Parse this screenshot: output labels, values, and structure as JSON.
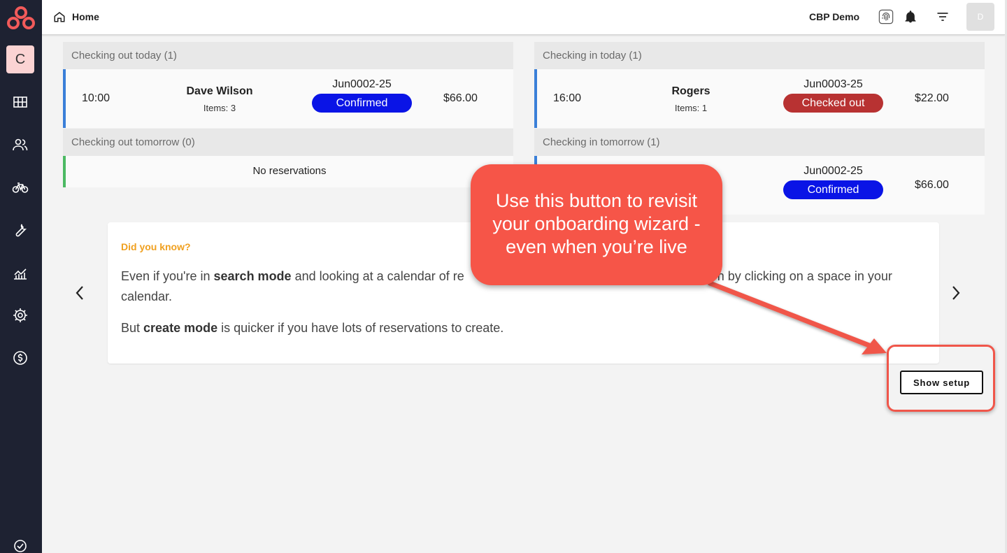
{
  "sidebar": {
    "workspace_initial": "C",
    "items": [
      {
        "icon": "grid-icon"
      },
      {
        "icon": "users-icon"
      },
      {
        "icon": "bike-icon"
      },
      {
        "icon": "wrench-icon"
      },
      {
        "icon": "analytics-icon"
      },
      {
        "icon": "gear-icon"
      },
      {
        "icon": "sync-dollar-icon"
      },
      {
        "icon": "check-gear-icon"
      }
    ]
  },
  "topbar": {
    "breadcrumb": "Home",
    "org_name": "CBP Demo",
    "avatar_initial": "D"
  },
  "checkout_today": {
    "header": "Checking out today (1)",
    "rows": [
      {
        "time": "10:00",
        "name": "Dave Wilson",
        "items": "Items: 3",
        "ref": "Jun0002-25",
        "status": "Confirmed",
        "price": "$66.00"
      }
    ]
  },
  "checkout_tomorrow": {
    "header": "Checking out tomorrow (0)",
    "empty_text": "No reservations"
  },
  "checkin_today": {
    "header": "Checking in today (1)",
    "rows": [
      {
        "time": "16:00",
        "name": "Rogers",
        "items": "Items: 1",
        "ref": "Jun0003-25",
        "status": "Checked out",
        "price": "$22.00"
      }
    ]
  },
  "checkin_tomorrow": {
    "header": "Checking in tomorrow (1)",
    "rows": [
      {
        "ref": "Jun0002-25",
        "status": "Confirmed",
        "price": "$66.00"
      }
    ]
  },
  "tip": {
    "title": "Did you know?",
    "line1_a": "Even if you're in ",
    "line1_b": "search mode",
    "line1_c": " and looking at a calendar of re",
    "line1_d": "n by clicking on a space in your",
    "line2": "calendar.",
    "line3_a": "But ",
    "line3_b": "create mode",
    "line3_c": " is quicker if you have lots of reservations to create."
  },
  "setup_button": "Show setup",
  "annotation": {
    "line1": "Use this button to revisit",
    "line2": "your onboarding wizard -",
    "line3": "even when you’re live"
  },
  "colors": {
    "sidebar": "#1e2232",
    "confirmed": "#0a14e6",
    "checked_out": "#b83232",
    "tip_title": "#f0a020",
    "annotation": "#f65548"
  }
}
